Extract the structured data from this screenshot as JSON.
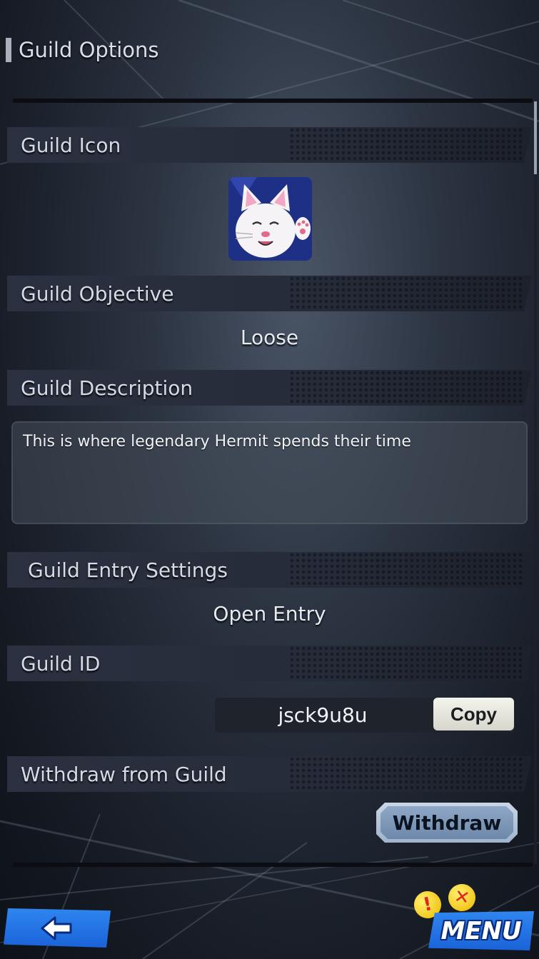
{
  "page": {
    "title": "Guild Options"
  },
  "sections": {
    "icon": {
      "label": "Guild Icon"
    },
    "objective": {
      "label": "Guild Objective",
      "value": "Loose"
    },
    "description": {
      "label": "Guild Description",
      "value": "This is where legendary Hermit spends their time"
    },
    "entry": {
      "label": "Guild Entry Settings",
      "value": "Open Entry"
    },
    "id": {
      "label": "Guild ID",
      "value": "jsck9u8u",
      "copy_label": "Copy"
    },
    "withdraw": {
      "label": "Withdraw from Guild",
      "button_label": "Withdraw"
    }
  },
  "footer": {
    "menu_label": "MENU"
  },
  "colors": {
    "accent_blue": "#1a63d8",
    "badge_yellow": "#f2c81e",
    "badge_red": "#e2261c"
  },
  "icons": {
    "back": "back-arrow-icon",
    "guild": "white-cat-icon",
    "notice": "exclamation-icon",
    "cross": "cross-icon"
  }
}
